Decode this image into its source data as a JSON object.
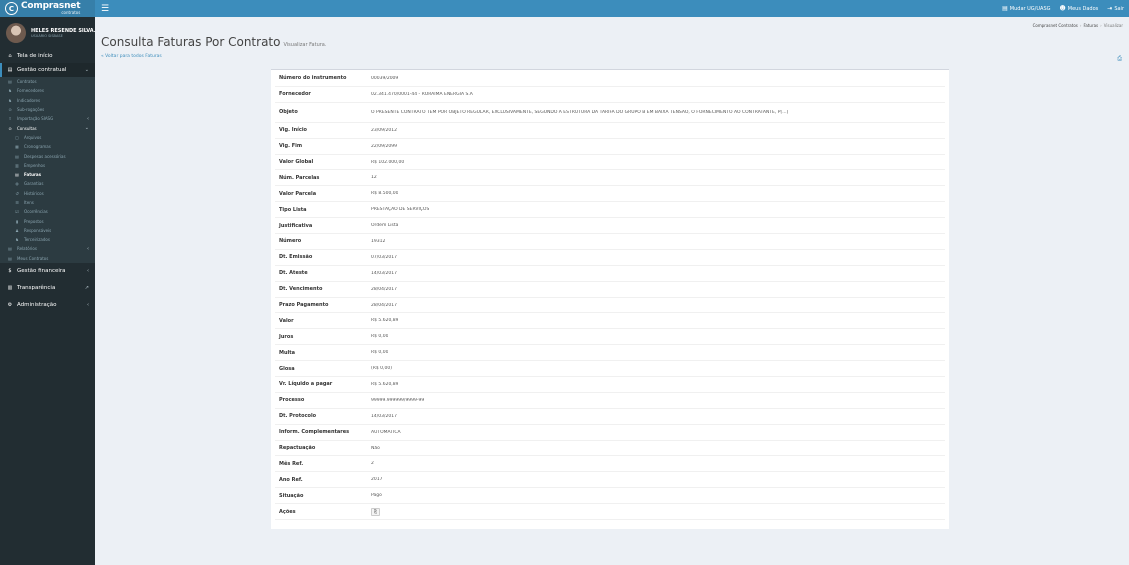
{
  "topbar": {
    "brand_name": "Comprasnet",
    "brand_sub": "contratos",
    "brand_initial": "C",
    "nav": [
      {
        "icon": "▤",
        "label": "Mudar UG/UASG"
      },
      {
        "icon": "☻",
        "label": "Meus Dados"
      },
      {
        "icon": "⇥",
        "label": "Sair"
      }
    ]
  },
  "user": {
    "name": "HELES RESENDE SILVA...",
    "role": "USUÁRIO SISBASE"
  },
  "sidebar": {
    "home": {
      "icon": "⌂",
      "label": "Tela de início"
    },
    "gestao_contratual": {
      "icon": "▤",
      "label": "Gestão contratual"
    },
    "gestao_items": [
      {
        "icon": "▤",
        "label": "Contratos"
      },
      {
        "icon": "♞",
        "label": "Fornecedores"
      },
      {
        "icon": "♞",
        "label": "Indicadores"
      },
      {
        "icon": "⊙",
        "label": "Sub-rogações"
      },
      {
        "icon": "⇪",
        "label": "Importação SIASG"
      }
    ],
    "consultas": {
      "icon": "⊙",
      "label": "Consultas"
    },
    "consultas_items": [
      {
        "icon": "▢",
        "label": "Arquivos"
      },
      {
        "icon": "▦",
        "label": "Cronogramas"
      },
      {
        "icon": "▤",
        "label": "Despesas acessórias"
      },
      {
        "icon": "▥",
        "label": "Empenhos"
      },
      {
        "icon": "▤",
        "label": "Faturas"
      },
      {
        "icon": "◍",
        "label": "Garantias"
      },
      {
        "icon": "↺",
        "label": "Históricos"
      },
      {
        "icon": "☰",
        "label": "Itens"
      },
      {
        "icon": "☑",
        "label": "Ocorrências"
      },
      {
        "icon": "▮",
        "label": "Prepostos"
      },
      {
        "icon": "♟",
        "label": "Responsáveis"
      },
      {
        "icon": "♞",
        "label": "Terceirizados"
      }
    ],
    "gestao_tail": [
      {
        "icon": "▤",
        "label": "Relatórios"
      },
      {
        "icon": "▤",
        "label": "Meus Contratos"
      }
    ],
    "bottom": [
      {
        "icon": "$",
        "label": "Gestão financeira"
      },
      {
        "icon": "▥",
        "label": "Transparência"
      },
      {
        "icon": "⚙",
        "label": "Administração"
      }
    ]
  },
  "page": {
    "title": "Consulta Faturas Por Contrato",
    "subtitle": "Visualizar Fatura.",
    "breadcrumb": [
      "Comprasnet Contratos",
      "Faturas",
      "Visualizar"
    ],
    "back_link": "« Voltar para todos Faturas"
  },
  "details": [
    {
      "label": "Número do instrumento",
      "value": "00039/2009"
    },
    {
      "label": "Fornecedor",
      "value": "02.341.470/0001-44 - RORAIMA ENERGIA S.A"
    },
    {
      "label": "Objeto",
      "value": "O PRESENTE CONTRATO TEM POR OBJETO REGULAR, EXCLUSIVAMENTE, SEGUNDO A ESTRUTURA DA TARIFA DO GRUPO B EM BAIXA TENSÃO, O FORNECIMENTO AO CONTRATANTE, P[...]"
    },
    {
      "label": "Vig. Início",
      "value": "23/09/2012"
    },
    {
      "label": "Vig. Fim",
      "value": "22/09/2099"
    },
    {
      "label": "Valor Global",
      "value": "R$ 102.000,00"
    },
    {
      "label": "Núm. Parcelas",
      "value": "12"
    },
    {
      "label": "Valor Parcela",
      "value": "R$ 8.500,00"
    },
    {
      "label": "Tipo Lista",
      "value": "PRESTAÇÃO DE SERVIÇOS"
    },
    {
      "label": "Justificativa",
      "value": "Ordem Lista"
    },
    {
      "label": "Número",
      "value": "19312"
    },
    {
      "label": "Dt. Emissão",
      "value": "07/03/2017"
    },
    {
      "label": "Dt. Ateste",
      "value": "14/03/2017"
    },
    {
      "label": "Dt. Vencimento",
      "value": "28/04/2017"
    },
    {
      "label": "Prazo Pagamento",
      "value": "28/04/2017"
    },
    {
      "label": "Valor",
      "value": "R$ 5.620,89"
    },
    {
      "label": "Juros",
      "value": "R$ 0,00"
    },
    {
      "label": "Multa",
      "value": "R$ 0,00"
    },
    {
      "label": "Glosa",
      "value": "(R$ 0,00)"
    },
    {
      "label": "Vr. Líquido a pagar",
      "value": "R$ 5.620,89"
    },
    {
      "label": "Processo",
      "value": "99999.999999/9999-99"
    },
    {
      "label": "Dt. Protocolo",
      "value": "14/03/2017"
    },
    {
      "label": "Inform. Complementares",
      "value": "AUTOMÁTICA"
    },
    {
      "label": "Repactuação",
      "value": "Não"
    },
    {
      "label": "Mês Ref.",
      "value": "2"
    },
    {
      "label": "Ano Ref.",
      "value": "2017"
    },
    {
      "label": "Situação",
      "value": "Pago"
    },
    {
      "label": "Ações",
      "value": "⎘"
    }
  ]
}
